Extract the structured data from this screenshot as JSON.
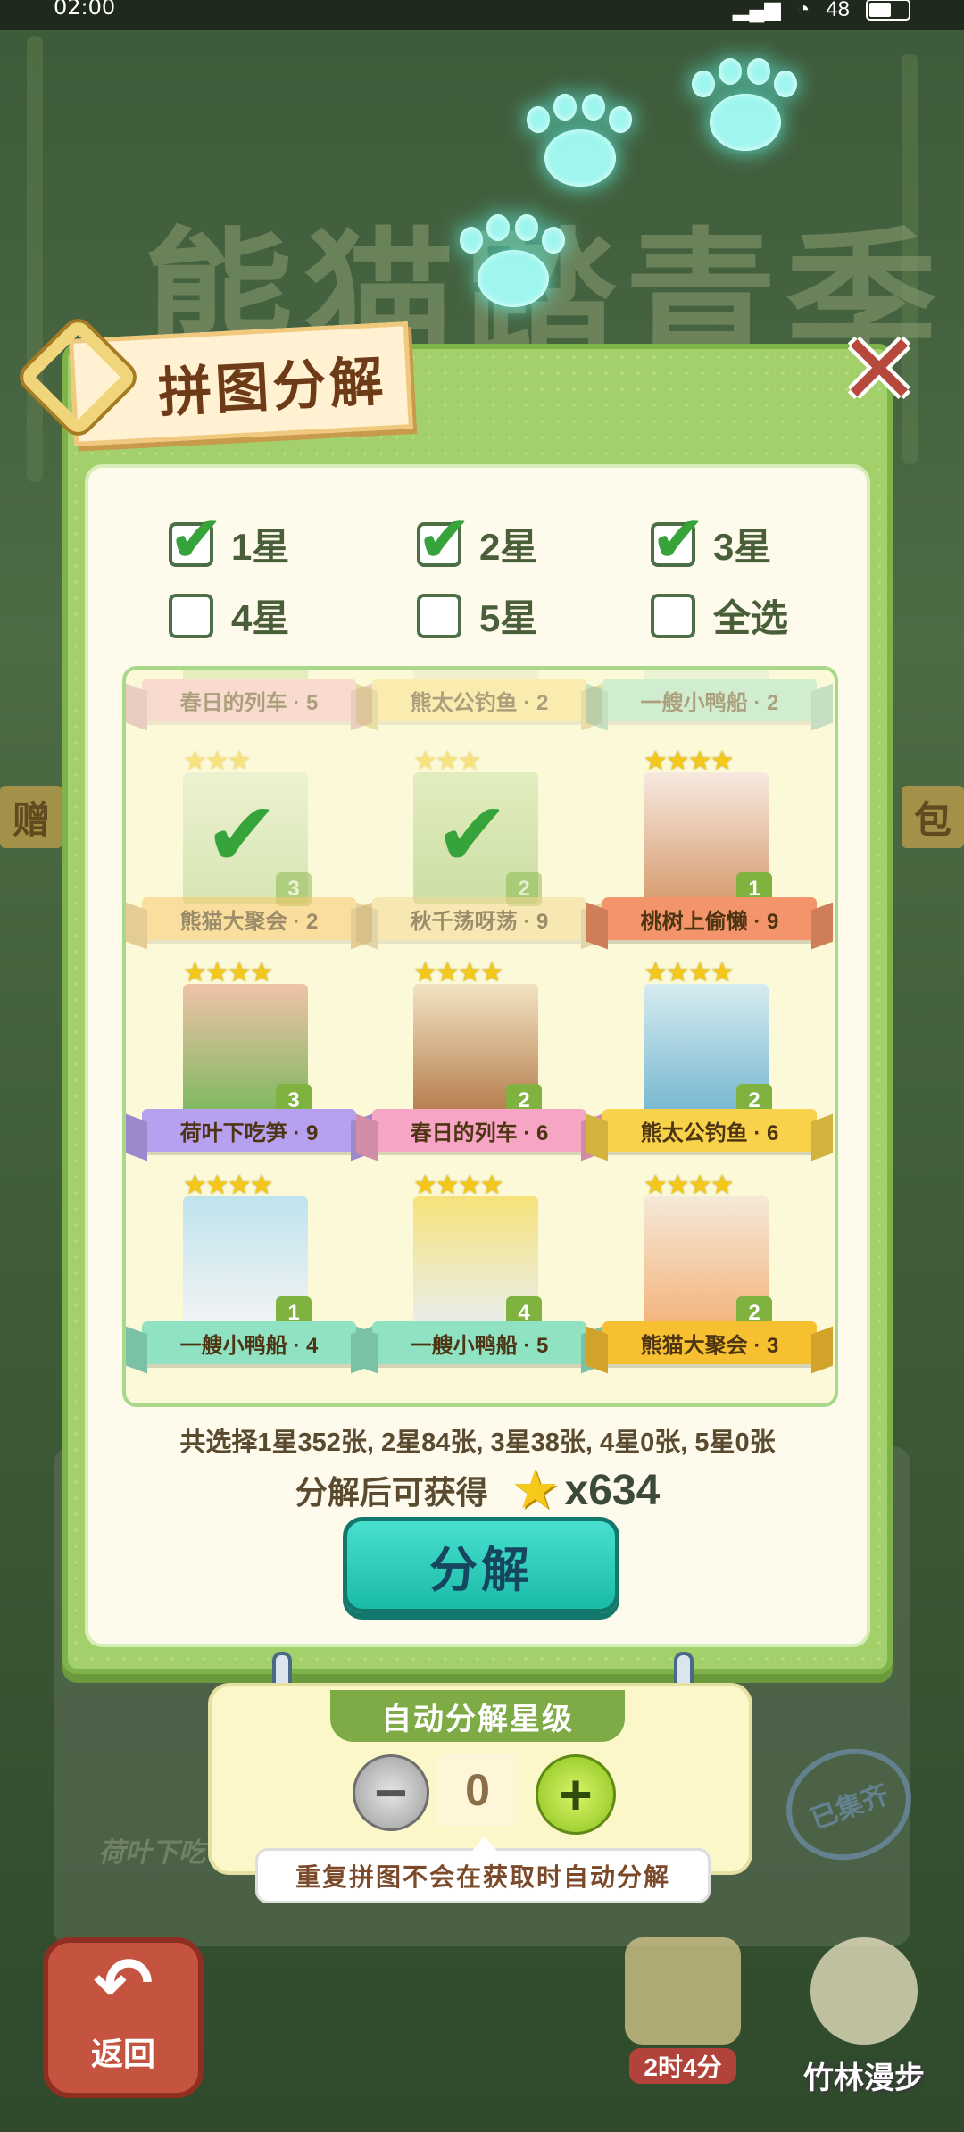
{
  "status_bar": {
    "time": "02:00",
    "battery": "48"
  },
  "background": {
    "title": "熊猫踏青季",
    "left_tag": "赠",
    "right_tag": "包",
    "stamp": "已集齐",
    "lotus_label": "荷叶下吃"
  },
  "dialog": {
    "title": "拼图分解",
    "filters": [
      {
        "label": "1星",
        "checked": true
      },
      {
        "label": "2星",
        "checked": true
      },
      {
        "label": "3星",
        "checked": true
      },
      {
        "label": "4星",
        "checked": false
      },
      {
        "label": "5星",
        "checked": false
      },
      {
        "label": "全选",
        "checked": false
      }
    ],
    "cards": [
      {
        "stars": "",
        "name": "春日的列车 · 5",
        "num": "",
        "selected": false
      },
      {
        "stars": "",
        "name": "熊太公钓鱼 · 2",
        "num": "",
        "selected": false
      },
      {
        "stars": "",
        "name": "一艘小鸭船 · 2",
        "num": "",
        "selected": false
      },
      {
        "stars": "★★★",
        "name": "熊猫大聚会 · 2",
        "num": "3",
        "selected": true
      },
      {
        "stars": "★★★",
        "name": "秋千荡呀荡 · 9",
        "num": "2",
        "selected": true
      },
      {
        "stars": "★★★★",
        "name": "桃树上偷懒 · 9",
        "num": "1",
        "selected": false
      },
      {
        "stars": "★★★★",
        "name": "荷叶下吃笋 · 9",
        "num": "3",
        "selected": false
      },
      {
        "stars": "★★★★",
        "name": "春日的列车 · 6",
        "num": "2",
        "selected": false
      },
      {
        "stars": "★★★★",
        "name": "熊太公钓鱼 · 6",
        "num": "2",
        "selected": false
      },
      {
        "stars": "★★★★",
        "name": "一艘小鸭船 · 4",
        "num": "1",
        "selected": false
      },
      {
        "stars": "★★★★",
        "name": "一艘小鸭船 · 5",
        "num": "4",
        "selected": false
      },
      {
        "stars": "★★★★",
        "name": "熊猫大聚会 · 3",
        "num": "2",
        "selected": false
      }
    ],
    "summary": "共选择1星352张, 2星84张, 3星38张, 4星0张, 5星0张",
    "reward_label": "分解后可获得",
    "reward_count": "x634",
    "decompose_label": "分解"
  },
  "auto_panel": {
    "title": "自动分解星级",
    "minus": "−",
    "value": "0",
    "plus": "+",
    "note": "重复拼图不会在获取时自动分解"
  },
  "bottom_nav": {
    "back_label": "返回",
    "timer_label": "2时4分",
    "bamboo_label": "竹林漫步"
  },
  "colors": {
    "dialog_green": "#a4d06b",
    "check_green": "#36a33b",
    "button_teal": "#1bbba8",
    "close_red": "#b6493c"
  }
}
